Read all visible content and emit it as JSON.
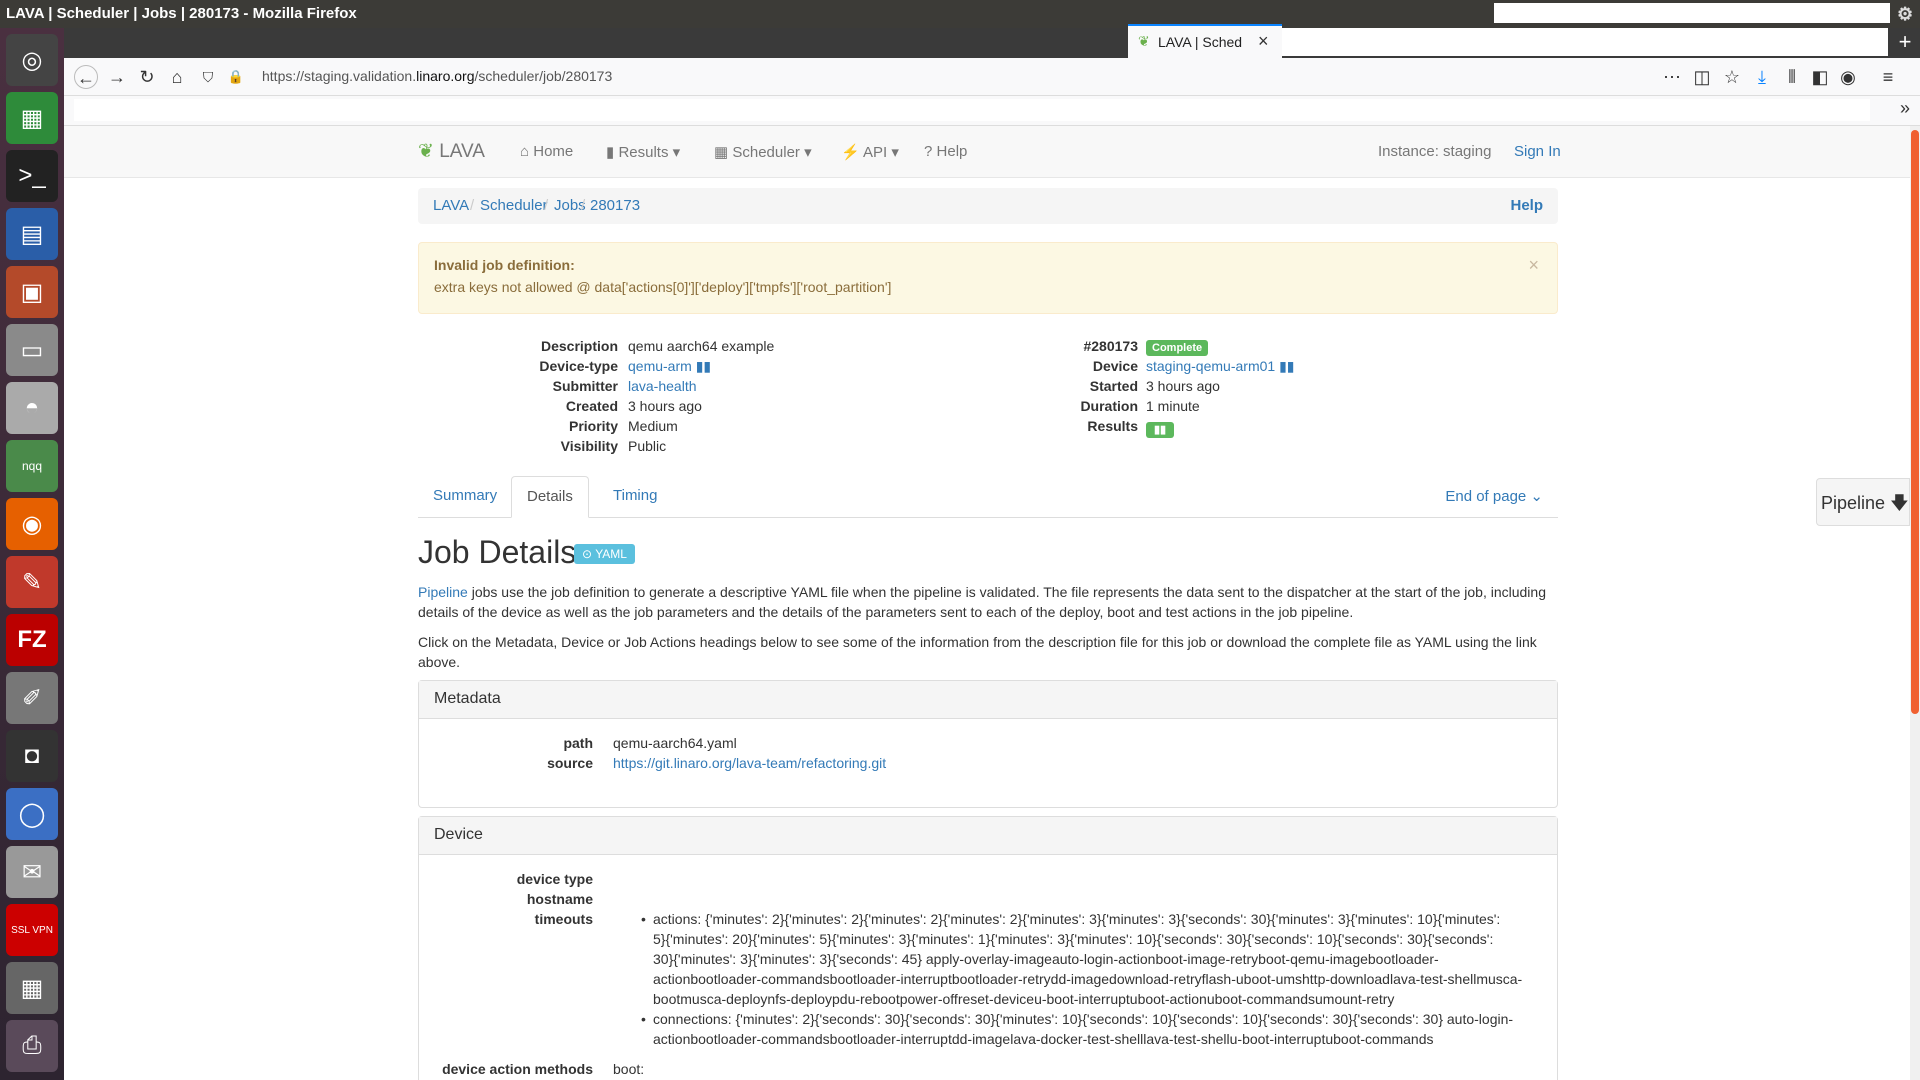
{
  "window": {
    "title": "LAVA | Scheduler | Jobs | 280173 - Mozilla Firefox"
  },
  "browser": {
    "tab_title": "LAVA | Sched",
    "url_prefix": "https://staging.validation.",
    "url_domain": "linaro.org",
    "url_path": "/scheduler/job/280173"
  },
  "dock": {
    "items": [
      "ubuntu-logo-icon",
      "spreadsheet-icon",
      "terminal-icon",
      "writer-icon",
      "impress-icon",
      "files-icon",
      "disk-icon",
      "nqq-icon",
      "firefox-icon",
      "evince-icon",
      "filezilla-icon",
      "text-editor-icon",
      "camera-icon",
      "chromium-icon",
      "mail-icon",
      "ssl-vpn-icon",
      "calculator-icon",
      "printer-icon"
    ],
    "vpn_label": "SSL VPN",
    "nqq_label": "nqq"
  },
  "nav": {
    "brand": "LAVA",
    "home": "Home",
    "results": "Results",
    "scheduler": "Scheduler",
    "api": "API",
    "help": "Help",
    "instance": "Instance: staging",
    "sign_in": "Sign In"
  },
  "breadcrumb": {
    "items": [
      "LAVA",
      "Scheduler",
      "Jobs",
      "280173"
    ],
    "help": "Help"
  },
  "alert": {
    "heading": "Invalid job definition:",
    "text": "extra keys not allowed @ data['actions[0]']['deploy']['tmpfs']['root_partition']"
  },
  "job_left": {
    "description_label": "Description",
    "description": "qemu aarch64 example",
    "device_type_label": "Device-type",
    "device_type": "qemu-arm",
    "submitter_label": "Submitter",
    "submitter": "lava-health",
    "created_label": "Created",
    "created": "3 hours ago",
    "priority_label": "Priority",
    "priority": "Medium",
    "visibility_label": "Visibility",
    "visibility": "Public"
  },
  "job_right": {
    "id": "#280173",
    "status": "Complete",
    "device_label": "Device",
    "device": "staging-qemu-arm01",
    "started_label": "Started",
    "started": "3 hours ago",
    "duration_label": "Duration",
    "duration": "1 minute",
    "results_label": "Results"
  },
  "tabs": {
    "summary": "Summary",
    "details": "Details",
    "timing": "Timing",
    "end_of_page": "End of page"
  },
  "details": {
    "title": "Job Details",
    "yaml_btn": "YAML",
    "para1_link": "Pipeline",
    "para1": " jobs use the job definition to generate a descriptive YAML file when the pipeline is validated. The file represents the data sent to the dispatcher at the start of the job, including details of the device as well as the job parameters and the details of the parameters sent to each of the deploy, boot and test actions in the job pipeline.",
    "para2": "Click on the Metadata, Device or Job Actions headings below to see some of the information from the description file for this job or download the complete file as YAML using the link above."
  },
  "metadata": {
    "heading": "Metadata",
    "path_label": "path",
    "path": "qemu-aarch64.yaml",
    "source_label": "source",
    "source": "https://git.linaro.org/lava-team/refactoring.git"
  },
  "device": {
    "heading": "Device",
    "device_type_label": "device type",
    "hostname_label": "hostname",
    "timeouts_label": "timeouts",
    "actions_line1": "actions: {'minutes': 2}{'minutes': 2}{'minutes': 2}{'minutes': 2}{'minutes': 3}{'minutes': 3}{'seconds': 30}{'minutes': 3}{'minutes': 10}{'minutes':",
    "actions_line2": "5}{'minutes': 20}{'minutes': 5}{'minutes': 3}{'minutes': 1}{'minutes': 3}{'minutes': 10}{'seconds': 30}{'seconds': 10}{'seconds': 30}{'seconds':",
    "actions_line3": "30}{'minutes': 3}{'minutes': 3}{'seconds': 45} apply-overlay-imageauto-login-actionboot-image-retryboot-qemu-imagebootloader-",
    "actions_line4": "actionbootloader-commandsbootloader-interruptbootloader-retrydd-imagedownload-retryflash-uboot-umshttp-downloadlava-test-shellmusca-",
    "actions_line5": "bootmusca-deploynfs-deploypdu-rebootpower-offreset-deviceu-boot-interruptuboot-actionuboot-commandsumount-retry",
    "connections_line1": "connections: {'minutes': 2}{'seconds': 30}{'seconds': 30}{'minutes': 10}{'seconds': 10}{'seconds': 10}{'seconds': 30}{'seconds': 30} auto-login-",
    "connections_line2": "actionbootloader-commandsbootloader-interruptdd-imagelava-docker-test-shelllava-test-shellu-boot-interruptuboot-commands",
    "methods_label": "device action methods",
    "methods_value": "boot:"
  },
  "pipeline_tab": "Pipeline"
}
